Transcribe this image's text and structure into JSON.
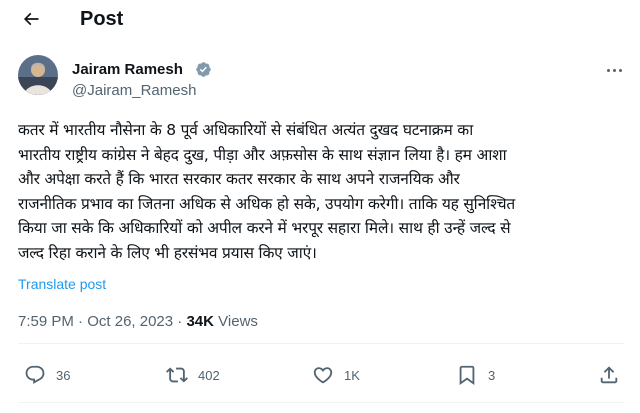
{
  "header": {
    "title": "Post"
  },
  "author": {
    "name": "Jairam Ramesh",
    "handle": "@Jairam_Ramesh",
    "verified": true
  },
  "tweet": {
    "lines": [
      "कतर में भारतीय नौसेना के 8 पूर्व अधिकारियों से संबंधित अत्यंत दुखद घटनाक्रम का",
      "भारतीय राष्ट्रीय कांग्रेस ने बेहद दुख, पीड़ा और अफ़सोस के साथ संज्ञान लिया है। हम आशा",
      "और अपेक्षा करते हैं कि भारत सरकार कतर सरकार के साथ अपने राजनयिक और",
      "राजनीतिक प्रभाव का जितना अधिक से अधिक हो सके, उपयोग करेगी। ताकि यह सुनिश्चित",
      "किया जा सके कि अधिकारियों को अपील करने में भरपूर सहारा मिले। साथ ही उन्हें जल्द से",
      "जल्द रिहा कराने के लिए भी हरसंभव प्रयास किए जाएं।"
    ],
    "translate_label": "Translate post"
  },
  "meta": {
    "time": "7:59 PM",
    "separator": "·",
    "date": "Oct 26, 2023",
    "views_count": "34K",
    "views_label": "Views"
  },
  "actions": {
    "replies": "36",
    "reposts": "402",
    "likes": "1K",
    "bookmarks": "3"
  },
  "colors": {
    "text": "#0f1419",
    "secondary": "#536471",
    "accent": "#1d9bf0",
    "divider": "#eff3f4"
  },
  "icons": [
    "back-arrow-icon",
    "verified-badge-icon",
    "more-icon",
    "reply-icon",
    "repost-icon",
    "like-icon",
    "bookmark-icon",
    "share-icon"
  ]
}
